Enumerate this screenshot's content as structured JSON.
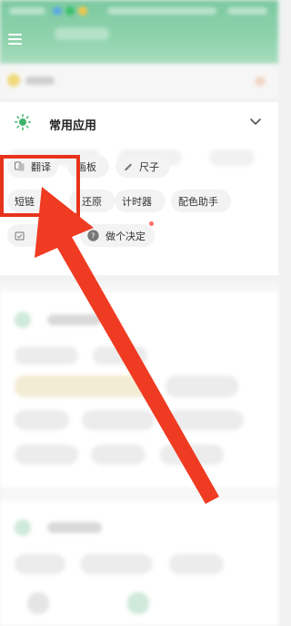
{
  "card": {
    "title": "常用应用"
  },
  "tools": [
    {
      "label": "翻译",
      "icon": "translate-icon"
    },
    {
      "label": "画板",
      "icon": "palette-icon"
    },
    {
      "label": "尺子",
      "icon": "ruler-icon"
    },
    {
      "label": "短链",
      "icon": ""
    },
    {
      "label": "还原",
      "icon": ""
    },
    {
      "label": "计时器",
      "icon": ""
    },
    {
      "label": "配色助手",
      "icon": ""
    },
    {
      "label": "",
      "icon": "calendar-icon"
    },
    {
      "label": "做个决定",
      "icon": "decision-icon"
    }
  ],
  "colors": {
    "header": "#8fd3ad",
    "highlight": "#e8331c",
    "arrow": "#ef3b22",
    "chip_bg": "#f3f3f3",
    "badge": "#ff6b6b"
  }
}
